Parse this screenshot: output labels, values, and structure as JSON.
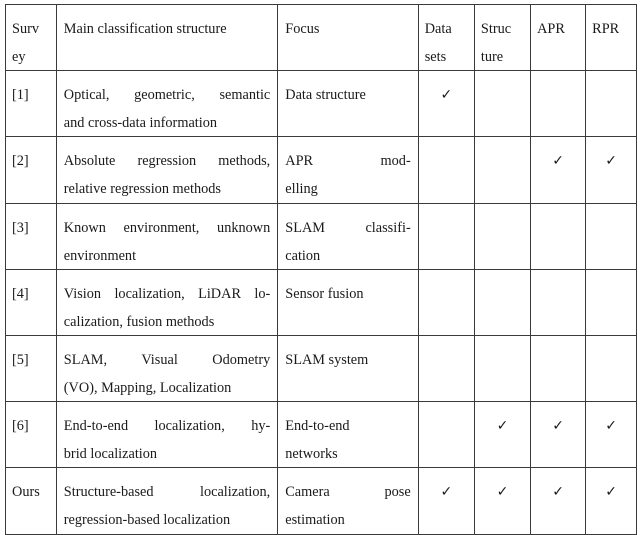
{
  "table": {
    "columns": [
      {
        "key": "survey",
        "label": "Survey"
      },
      {
        "key": "structure_desc",
        "label": "Main classification structure"
      },
      {
        "key": "focus",
        "label": "Focus"
      },
      {
        "key": "datasets",
        "label": "Datasets"
      },
      {
        "key": "structure",
        "label": "Structure"
      },
      {
        "key": "apr",
        "label": "APR"
      },
      {
        "key": "rpr",
        "label": "RPR"
      }
    ],
    "header_lines": {
      "survey": [
        "Surv",
        "ey"
      ],
      "structure_desc": [
        "Main classification structure"
      ],
      "focus": [
        "Focus"
      ],
      "datasets": [
        "Data",
        "sets"
      ],
      "structure": [
        "Struc",
        "ture"
      ],
      "apr": [
        "APR"
      ],
      "rpr": [
        "RPR"
      ]
    },
    "check_symbol": "✓",
    "rows": [
      {
        "survey": "[1]",
        "main_lines": [
          "Optical, geometric, semantic",
          "and cross-data information"
        ],
        "focus_lines": [
          "Data structure"
        ],
        "datasets": true,
        "structure": false,
        "apr": false,
        "rpr": false
      },
      {
        "survey": "[2]",
        "main_lines": [
          "Absolute regression methods,",
          "relative regression methods"
        ],
        "focus_lines": [
          "APR mod-",
          "elling"
        ],
        "datasets": false,
        "structure": false,
        "apr": true,
        "rpr": true
      },
      {
        "survey": "[3]",
        "main_lines": [
          "Known environment, unknown",
          "environment"
        ],
        "focus_lines": [
          "SLAM classifi-",
          "cation"
        ],
        "datasets": false,
        "structure": false,
        "apr": false,
        "rpr": false
      },
      {
        "survey": "[4]",
        "main_lines": [
          "Vision localization, LiDAR lo-",
          "calization, fusion methods"
        ],
        "focus_lines": [
          "Sensor fusion"
        ],
        "datasets": false,
        "structure": false,
        "apr": false,
        "rpr": false
      },
      {
        "survey": "[5]",
        "main_lines": [
          "SLAM, Visual Odometry",
          "(VO), Mapping, Localization"
        ],
        "focus_lines": [
          "SLAM system"
        ],
        "datasets": false,
        "structure": false,
        "apr": false,
        "rpr": false
      },
      {
        "survey": "[6]",
        "main_lines": [
          "End-to-end localization, hy-",
          "brid localization"
        ],
        "focus_lines": [
          "End-to-end",
          "networks"
        ],
        "datasets": false,
        "structure": true,
        "apr": true,
        "rpr": true
      },
      {
        "survey": "Ours",
        "main_lines": [
          "Structure-based localization,",
          "regression-based localization"
        ],
        "focus_lines": [
          "Camera pose",
          "estimation"
        ],
        "datasets": true,
        "structure": true,
        "apr": true,
        "rpr": true
      }
    ]
  }
}
